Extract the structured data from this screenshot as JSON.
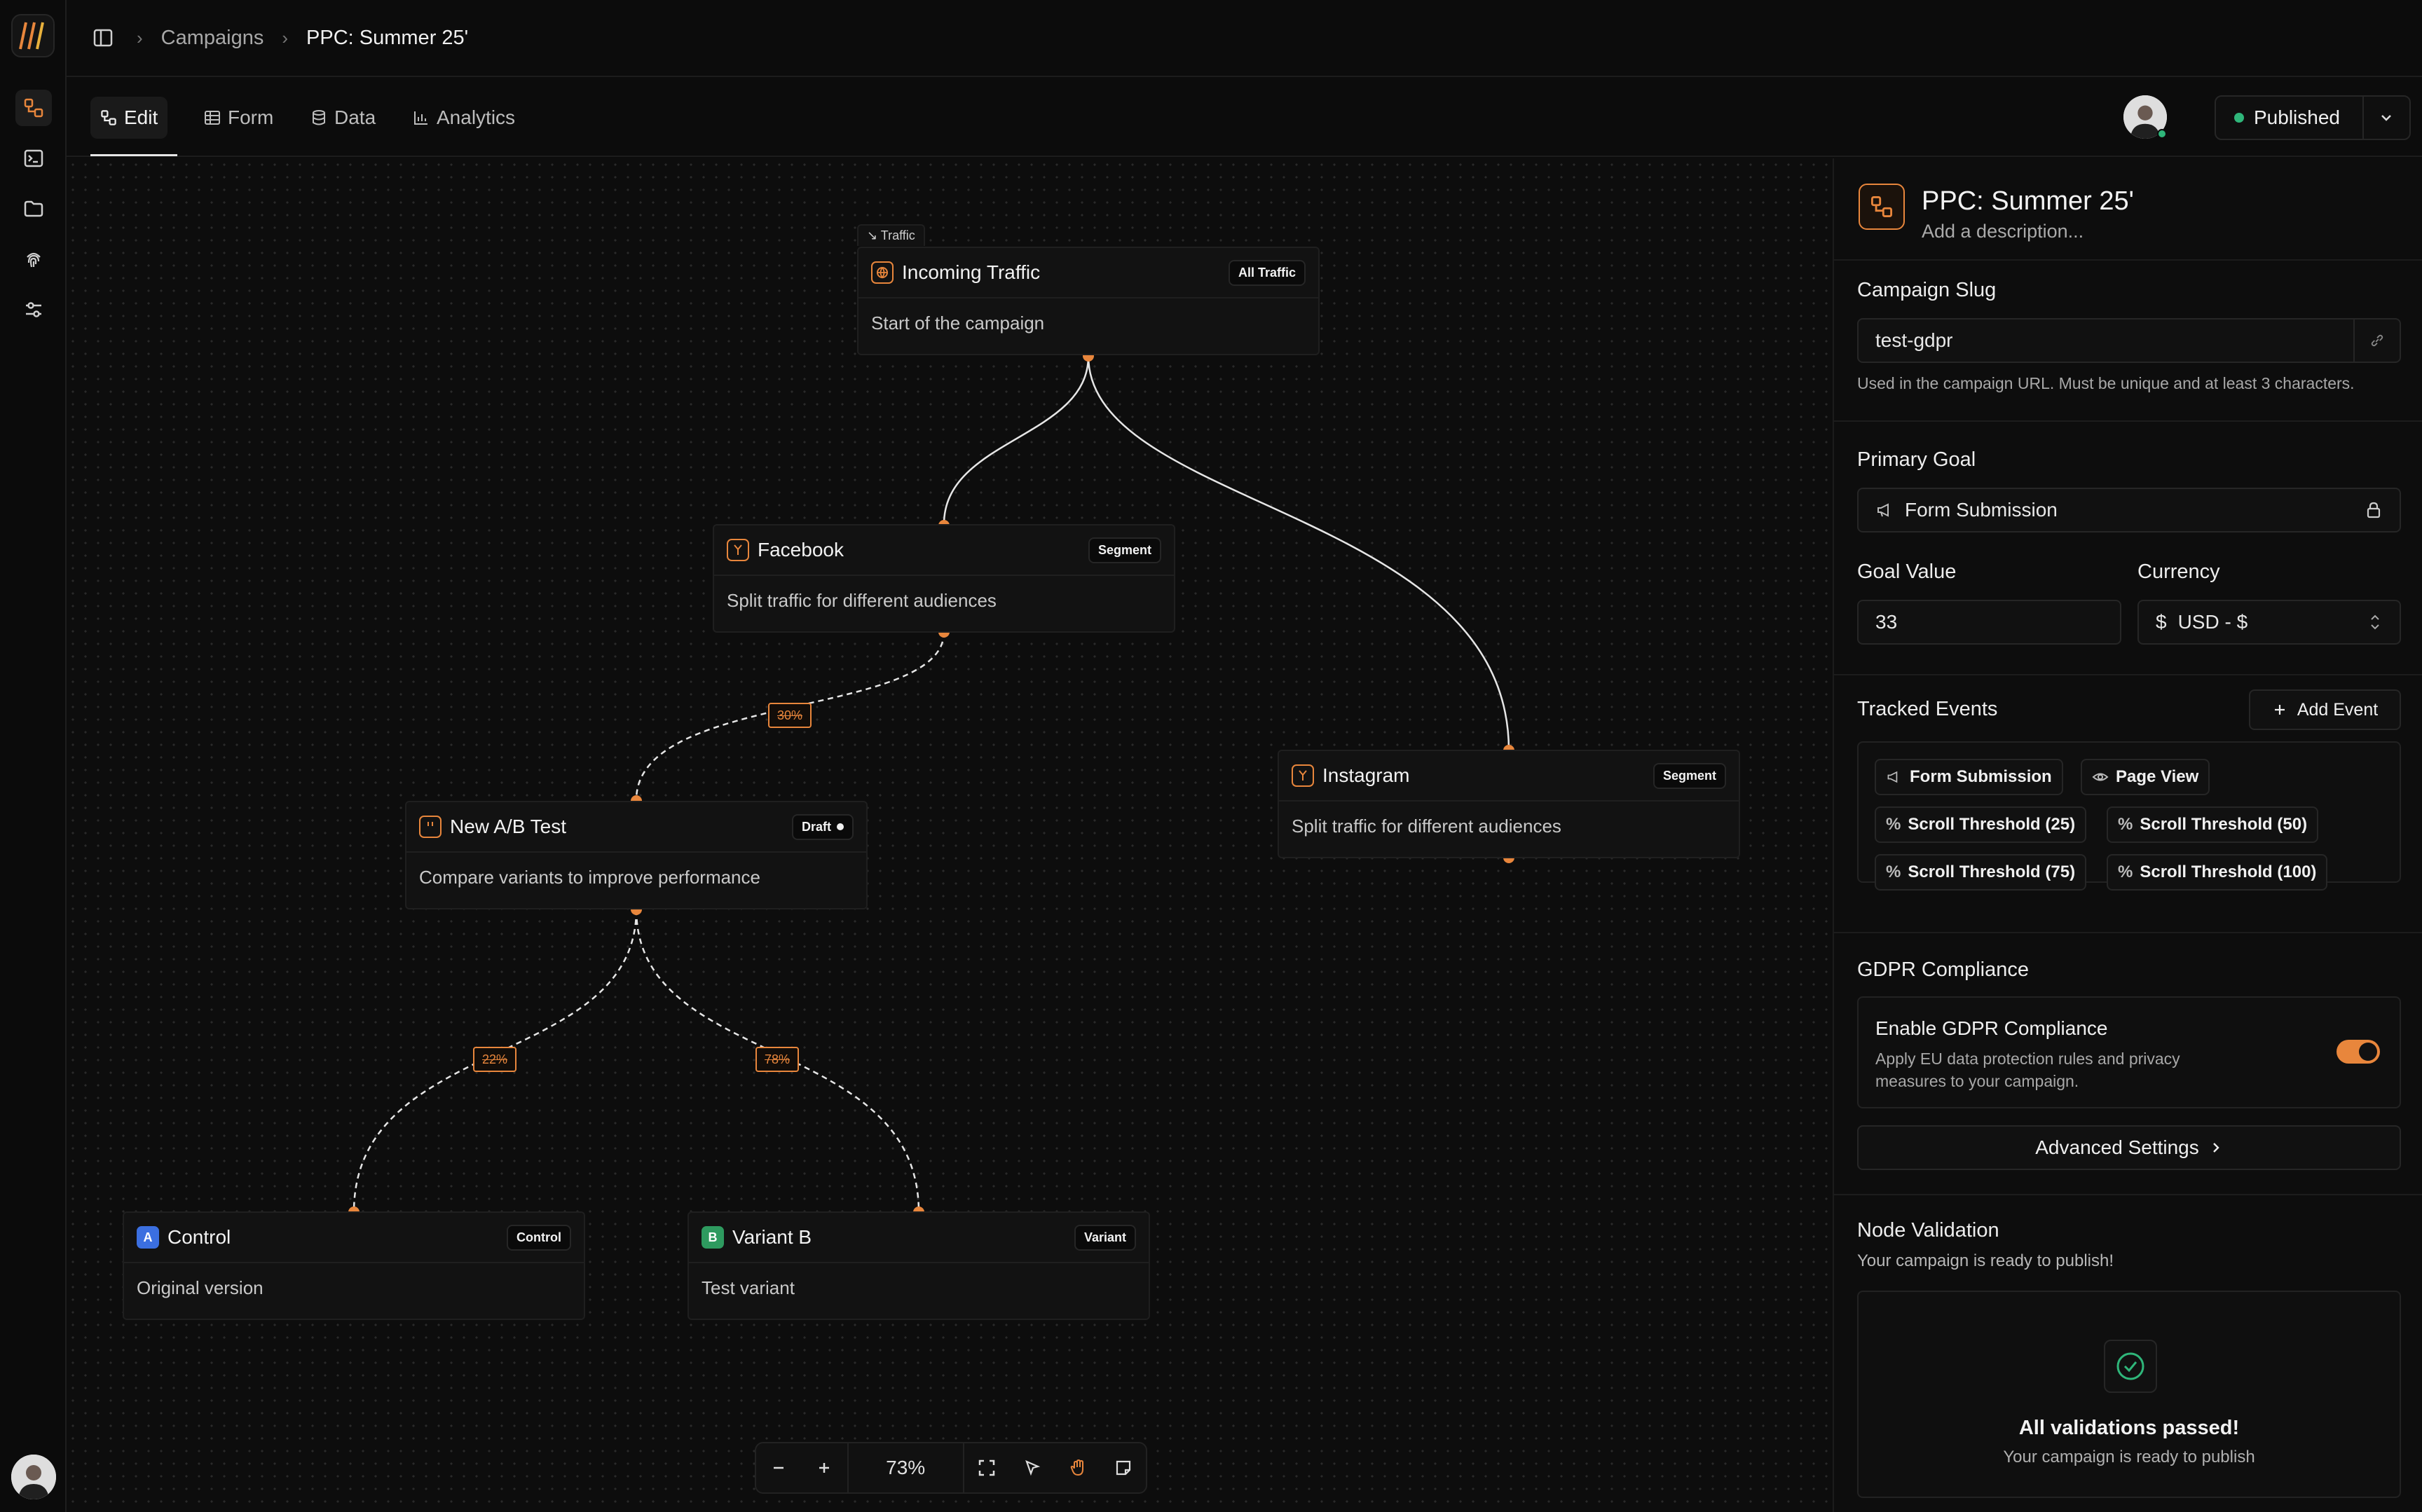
{
  "breadcrumbs": {
    "parent": "Campaigns",
    "current": "PPC: Summer 25'"
  },
  "tabs": [
    {
      "label": "Edit"
    },
    {
      "label": "Form"
    },
    {
      "label": "Data"
    },
    {
      "label": "Analytics"
    }
  ],
  "status": {
    "label": "Published",
    "color": "#2fb67a"
  },
  "accent": "#e8863c",
  "canvas": {
    "traffic_tag": "Traffic",
    "nodes": {
      "incoming": {
        "title": "Incoming Traffic",
        "badge": "All Traffic",
        "desc": "Start of the campaign",
        "icon": "globe-icon"
      },
      "facebook": {
        "title": "Facebook",
        "badge": "Segment",
        "desc": "Split traffic for different audiences",
        "icon": "split-icon"
      },
      "instagram": {
        "title": "Instagram",
        "badge": "Segment",
        "desc": "Split traffic for different audiences",
        "icon": "split-icon"
      },
      "abtest": {
        "title": "New A/B Test",
        "badge": "Draft",
        "desc": "Compare variants to improve performance",
        "icon": "flask-icon"
      },
      "control": {
        "title": "Control",
        "badge": "Control",
        "desc": "Original version",
        "letter": "A"
      },
      "variantb": {
        "title": "Variant B",
        "badge": "Variant",
        "desc": "Test variant",
        "letter": "B"
      }
    },
    "edge_labels": {
      "fb_to_ab": "30%",
      "ab_to_control": "22%",
      "ab_to_variant": "78%"
    },
    "zoom": "73%"
  },
  "panel": {
    "title": "PPC: Summer 25'",
    "description_placeholder": "Add a description...",
    "slug": {
      "label": "Campaign Slug",
      "value": "test-gdpr",
      "hint": "Used in the campaign URL. Must be unique and at least 3 characters."
    },
    "goal": {
      "label": "Primary Goal",
      "value": "Form Submission"
    },
    "goal_value": {
      "label": "Goal Value",
      "value": "33"
    },
    "currency": {
      "label": "Currency",
      "symbol": "$",
      "value": "USD - $"
    },
    "events": {
      "label": "Tracked Events",
      "add_label": "Add Event",
      "items": [
        "Form Submission",
        "Page View",
        "Scroll Threshold (25)",
        "Scroll Threshold (50)",
        "Scroll Threshold (75)",
        "Scroll Threshold (100)"
      ]
    },
    "gdpr": {
      "section": "GDPR Compliance",
      "title": "Enable GDPR Compliance",
      "desc1": "Apply EU data protection rules and privacy",
      "desc2": "measures to your campaign.",
      "enabled": true
    },
    "advanced": "Advanced Settings",
    "validation": {
      "label": "Node Validation",
      "sub": "Your campaign is ready to publish!",
      "result": "All validations passed!",
      "result_sub": "Your campaign is ready to publish"
    }
  }
}
